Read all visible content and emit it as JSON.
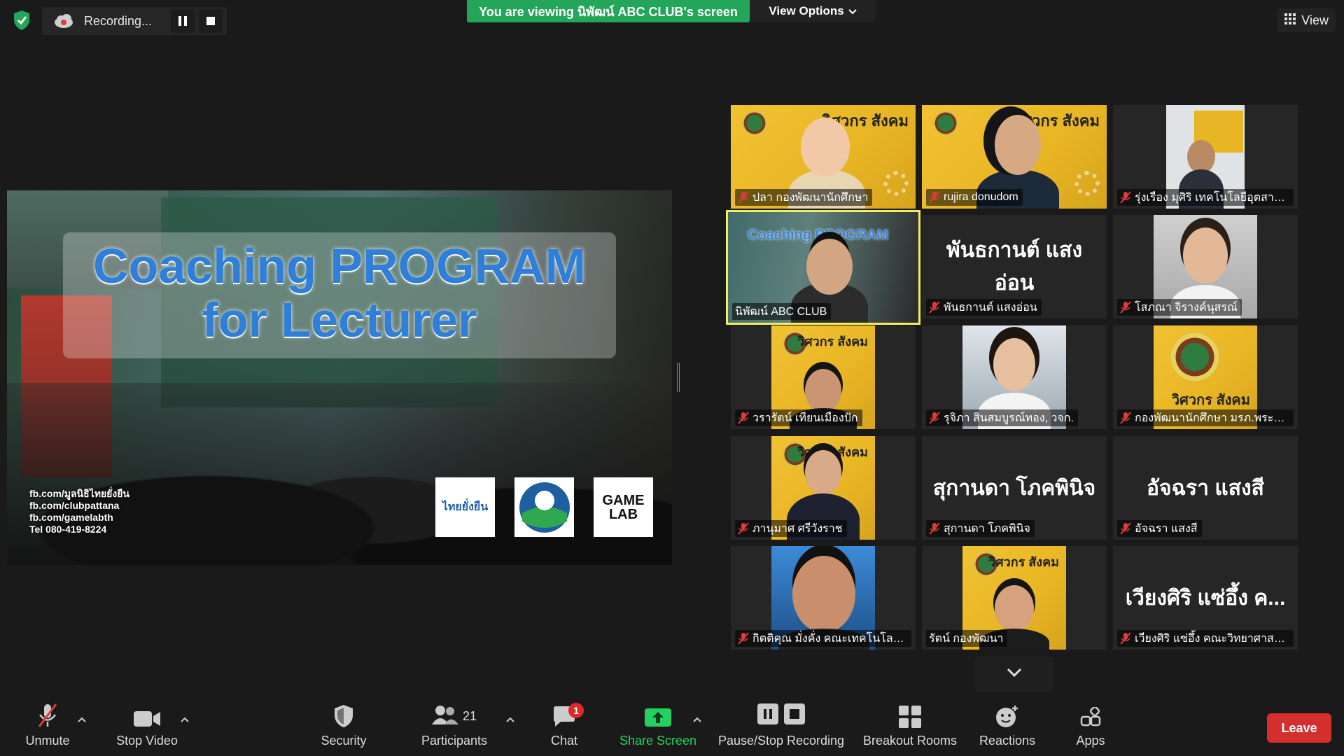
{
  "top": {
    "recording_label": "Recording...",
    "viewing_banner": "You are viewing นิพัฒน์ ABC CLUB's screen",
    "view_options": "View Options",
    "view_button": "View"
  },
  "screen": {
    "title_line1": "Coaching PROGRAM",
    "title_line2": "for Lecturer",
    "contacts": [
      "fb.com/มูลนิธิไทยยั่งยืน",
      "fb.com/clubpattana",
      "fb.com/gamelabth",
      "Tel 080-419-8224"
    ],
    "logo_thai": "ไทยยั่งยืน",
    "logo_game_line1": "GAME",
    "logo_game_line2": "LAB"
  },
  "participants": [
    {
      "name": "ปลา กองพัฒนานักศึกษา",
      "muted": true
    },
    {
      "name": "rujira donudom",
      "muted": true
    },
    {
      "name": "รุ่งเรือง มุศิริ เทคโนโลยีอุตสาหกร...",
      "muted": true
    },
    {
      "name": "นิพัฒน์ ABC CLUB",
      "muted": false,
      "active": true
    },
    {
      "name": "พันธกานต์ แสงอ่อน",
      "muted": true,
      "display_text": "พันธกานต์ แสงอ่อน"
    },
    {
      "name": "โสภณา จิรางค์นุสรณ์",
      "muted": true
    },
    {
      "name": "วรารัตน์ เทียนเมืองปัก",
      "muted": true
    },
    {
      "name": "รุจิภา สินสมบูรณ์ทอง, วจก.",
      "muted": true
    },
    {
      "name": "กองพัฒนานักศึกษา มรภ.พระนคร",
      "muted": true
    },
    {
      "name": "ภานุมาศ ศรีวังราช",
      "muted": true
    },
    {
      "name": "สุกานดา โภคพินิจ",
      "muted": true,
      "display_text": "สุกานดา โภคพินิจ"
    },
    {
      "name": "อัจฉรา แสงสี",
      "muted": true,
      "display_text": "อัจฉรา แสงสี"
    },
    {
      "name": "กิตติคุณ มั่งคั่ง คณะเทคโนโลยีอุ...",
      "muted": true
    },
    {
      "name": "รัตน์ กองพัฒนา",
      "muted": true
    },
    {
      "name": "เวียงศิริ แซ่อึ้ง คณะวิทยาศาสต...",
      "muted": true,
      "display_text": "เวียงศิริ แซ่อึ้ง ค..."
    }
  ],
  "tile_brand": "วิศวกร สังคม",
  "toolbar": {
    "unmute": "Unmute",
    "stop_video": "Stop Video",
    "security": "Security",
    "participants": "Participants",
    "participants_count": "21",
    "chat": "Chat",
    "chat_badge": "1",
    "share_screen": "Share Screen",
    "pause_stop": "Pause/Stop Recording",
    "breakout": "Breakout Rooms",
    "reactions": "Reactions",
    "apps": "Apps",
    "leave": "Leave"
  },
  "colors": {
    "banner_green": "#23a55a",
    "share_green": "#23d160",
    "leave_red": "#d42e2e",
    "active_outline": "#f2ee57",
    "tile_yellow": "#f1c232"
  }
}
